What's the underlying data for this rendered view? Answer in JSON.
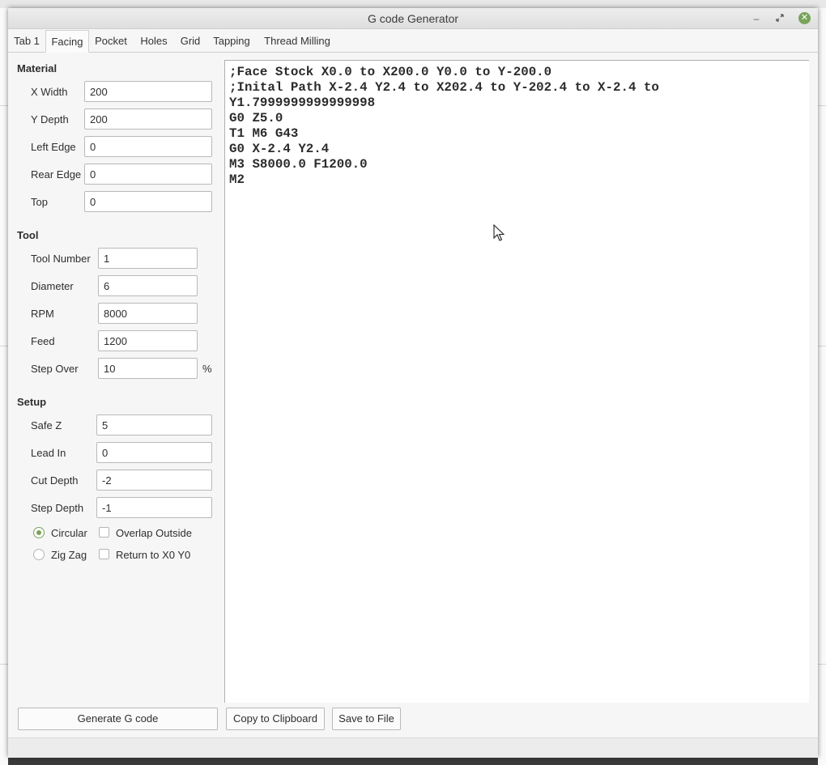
{
  "window": {
    "title": "G code Generator"
  },
  "tabs": [
    {
      "label": "Tab 1"
    },
    {
      "label": "Facing"
    },
    {
      "label": "Pocket"
    },
    {
      "label": "Holes"
    },
    {
      "label": "Grid"
    },
    {
      "label": "Tapping"
    },
    {
      "label": "Thread Milling"
    }
  ],
  "active_tab": "Facing",
  "material": {
    "heading": "Material",
    "fields": [
      {
        "label": "X Width",
        "value": "200"
      },
      {
        "label": "Y Depth",
        "value": "200"
      },
      {
        "label": "Left Edge",
        "value": "0"
      },
      {
        "label": "Rear Edge",
        "value": "0"
      },
      {
        "label": "Top",
        "value": "0"
      }
    ]
  },
  "tool": {
    "heading": "Tool",
    "fields": [
      {
        "label": "Tool Number",
        "value": "1"
      },
      {
        "label": "Diameter",
        "value": "6"
      },
      {
        "label": "RPM",
        "value": "8000"
      },
      {
        "label": "Feed",
        "value": "1200"
      },
      {
        "label": "Step Over",
        "value": "10",
        "unit": "%"
      }
    ]
  },
  "setup": {
    "heading": "Setup",
    "fields": [
      {
        "label": "Safe Z",
        "value": "5"
      },
      {
        "label": "Lead In",
        "value": "0"
      },
      {
        "label": "Cut Depth",
        "value": "-2"
      },
      {
        "label": "Step Depth",
        "value": "-1"
      }
    ],
    "radios": [
      {
        "label": "Circular",
        "checked": true
      },
      {
        "label": "Zig Zag",
        "checked": false
      }
    ],
    "checkboxes": [
      {
        "label": "Overlap Outside",
        "checked": false
      },
      {
        "label": "Return to X0 Y0",
        "checked": false
      }
    ]
  },
  "output": {
    "lines": [
      ";Face Stock X0.0 to X200.0 Y0.0 to Y-200.0",
      ";Inital Path X-2.4 Y2.4 to X202.4 to Y-202.4 to X-2.4 to",
      "Y1.7999999999999998",
      "G0 Z5.0",
      "T1 M6 G43",
      "G0 X-2.4 Y2.4",
      "M3 S8000.0 F1200.0",
      "M2"
    ]
  },
  "buttons": {
    "generate": "Generate G code",
    "copy": "Copy to Clipboard",
    "save": "Save to File"
  },
  "icons": {
    "minimize": "minimize-icon",
    "maximize": "maximize-icon",
    "close": "close-icon"
  },
  "colors": {
    "accent": "#7aa35b",
    "window_bg": "#f6f6f6"
  }
}
